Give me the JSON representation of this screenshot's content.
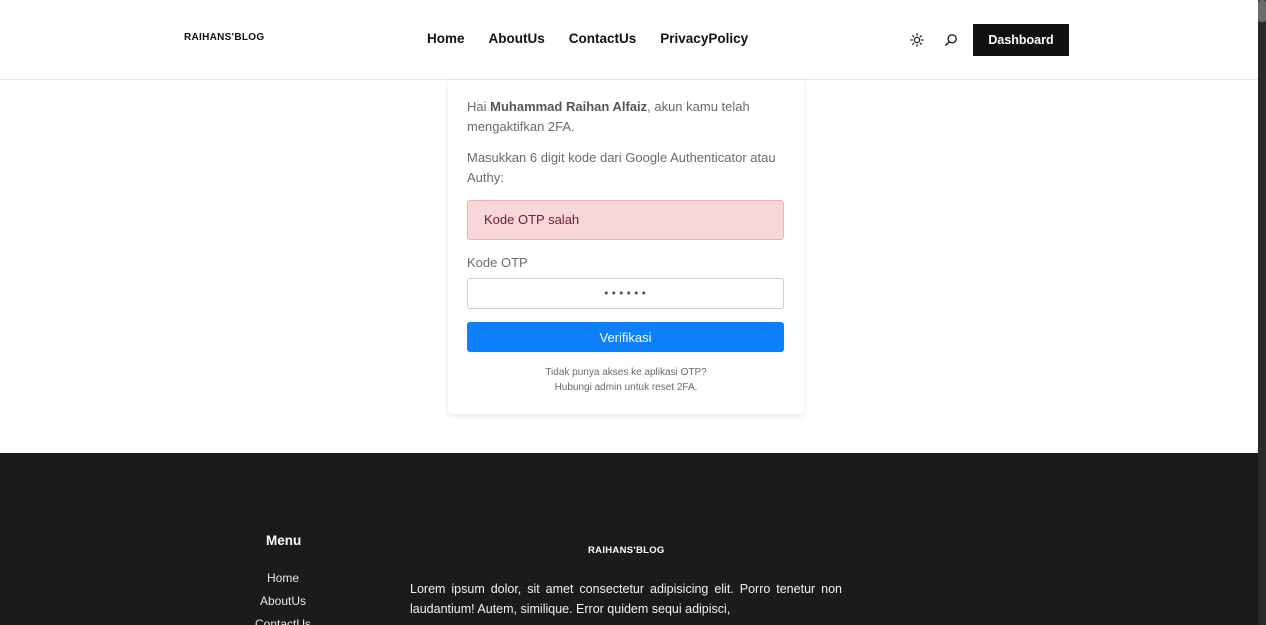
{
  "header": {
    "logo": "RAIHANS'BLOG",
    "nav": [
      "Home",
      "AboutUs",
      "ContactUs",
      "PrivacyPolicy"
    ],
    "icons": [
      "sun-icon",
      "search-icon"
    ],
    "dashboard_label": "Dashboard"
  },
  "card": {
    "greeting_prefix": "Hai ",
    "user_name": "Muhammad Raihan Alfaiz",
    "greeting_suffix": ", akun kamu telah mengaktifkan 2FA.",
    "instruction": "Masukkan 6 digit kode dari Google Authenticator atau Authy:",
    "alert": "Kode OTP salah",
    "otp_label": "Kode OTP",
    "otp_value": "••••••",
    "verify_label": "Verifikasi",
    "help_line1": "Tidak punya akses ke aplikasi OTP?",
    "help_line2": "Hubungi admin untuk reset 2FA."
  },
  "footer": {
    "menu_title": "Menu",
    "menu_items": [
      "Home",
      "AboutUs",
      "ContactUs"
    ],
    "logo": "RAIHANS'BLOG",
    "text": "Lorem ipsum dolor, sit amet consectetur adipisicing elit. Porro tenetur non laudantium! Autem, similique. Error quidem sequi adipisci,"
  },
  "colors": {
    "accent": "#0d7ffb",
    "dark": "#1c1b1b",
    "alert_bg": "#f8d7da",
    "alert_text": "#721c24"
  }
}
